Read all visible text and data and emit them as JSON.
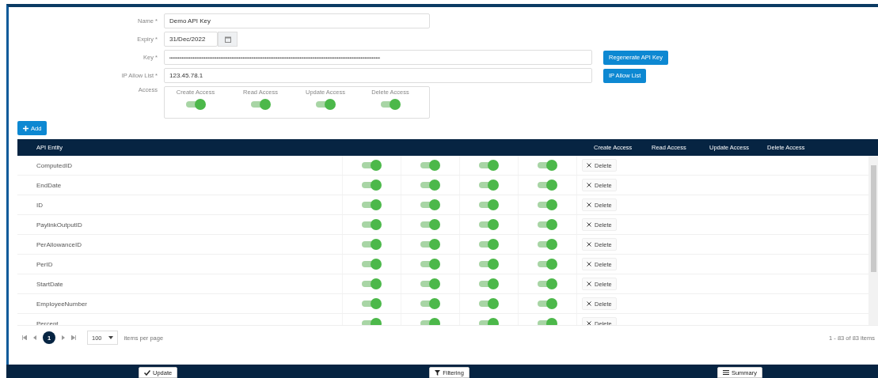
{
  "form": {
    "name": {
      "label": "Name *",
      "value": "Demo API Key"
    },
    "expiry": {
      "label": "Expiry *",
      "value": "31/Dec/2022"
    },
    "key": {
      "label": "Key *",
      "value": "••••••••••••••••••••••••••••••••••••••••••••••••••••••••••••••••••••••••••••••••••••••••••••••••••••••••••••••••••••••••••••••••••••••••••••••••••••••••",
      "button": "Regenerate API Key"
    },
    "ip_allow_list": {
      "label": "IP Allow List *",
      "value": "123.45.78.1",
      "button": "IP Allow List"
    },
    "access": {
      "label": "Access",
      "toggles": [
        {
          "label": "Create Access",
          "on": true
        },
        {
          "label": "Read Access",
          "on": true
        },
        {
          "label": "Update Access",
          "on": true
        },
        {
          "label": "Delete Access",
          "on": true
        }
      ]
    }
  },
  "add_button": "Add",
  "table": {
    "columns": [
      "API Entity",
      "Create Access",
      "Read Access",
      "Update Access",
      "Delete Access"
    ],
    "rows": [
      {
        "entity": "ComputedID",
        "create": true,
        "read": true,
        "update": true,
        "delete": true,
        "action": "Delete"
      },
      {
        "entity": "EndDate",
        "create": true,
        "read": true,
        "update": true,
        "delete": true,
        "action": "Delete"
      },
      {
        "entity": "ID",
        "create": true,
        "read": true,
        "update": true,
        "delete": true,
        "action": "Delete"
      },
      {
        "entity": "PaylinkOutputID",
        "create": true,
        "read": true,
        "update": true,
        "delete": true,
        "action": "Delete"
      },
      {
        "entity": "PerAllowanceID",
        "create": true,
        "read": true,
        "update": true,
        "delete": true,
        "action": "Delete"
      },
      {
        "entity": "PerID",
        "create": true,
        "read": true,
        "update": true,
        "delete": true,
        "action": "Delete"
      },
      {
        "entity": "StartDate",
        "create": true,
        "read": true,
        "update": true,
        "delete": true,
        "action": "Delete"
      },
      {
        "entity": "EmployeeNumber",
        "create": true,
        "read": true,
        "update": true,
        "delete": true,
        "action": "Delete"
      },
      {
        "entity": "Percent",
        "create": true,
        "read": true,
        "update": true,
        "delete": true,
        "action": "Delete"
      }
    ]
  },
  "pager": {
    "pages": [
      {
        "label": "1",
        "selected": true
      }
    ],
    "page_size": "100",
    "page_size_label": "items per page",
    "summary": "1 - 83 of 83 items"
  },
  "footer_buttons": [
    {
      "kind": "update",
      "label": "Update"
    },
    {
      "kind": "filter",
      "label": "Filtering"
    },
    {
      "kind": "summary",
      "label": "Summary"
    }
  ]
}
